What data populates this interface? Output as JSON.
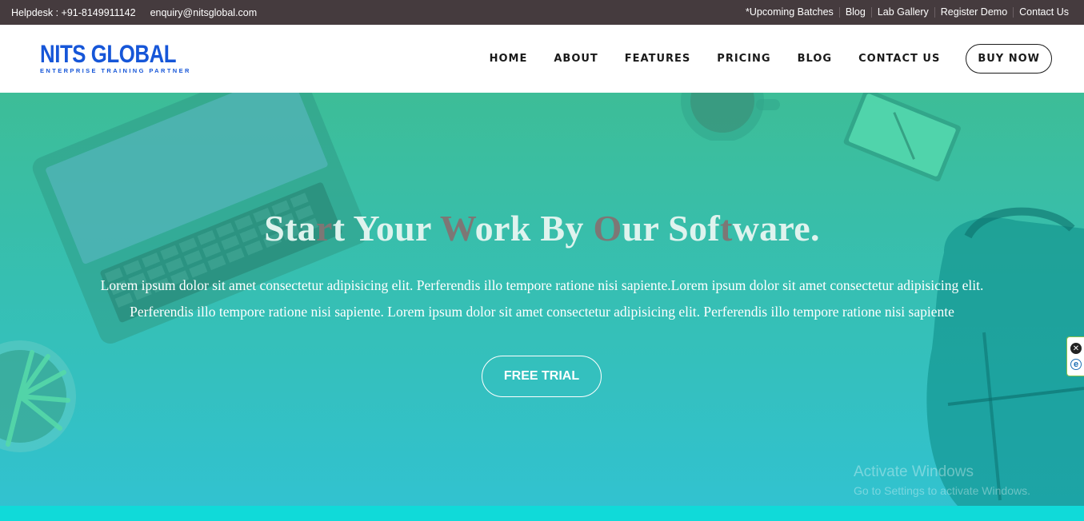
{
  "topbar": {
    "helpdesk": "Helpdesk : +91-8149911142",
    "email": "enquiry@nitsglobal.com",
    "links": [
      "*Upcoming Batches",
      "Blog",
      "Lab Gallery",
      "Register Demo",
      "Contact Us"
    ]
  },
  "logo": {
    "main": "NITS GLOBAL",
    "tagline": "ENTERPRISE TRAINING PARTNER"
  },
  "nav": {
    "items": [
      "HOME",
      "ABOUT",
      "FEATURES",
      "PRICING",
      "BLOG",
      "CONTACT US"
    ],
    "cta": "BUY NOW"
  },
  "hero": {
    "title_parts": [
      {
        "t": "Sta",
        "hl": false
      },
      {
        "t": "r",
        "hl": true
      },
      {
        "t": "t Your ",
        "hl": false
      },
      {
        "t": "W",
        "hl": true
      },
      {
        "t": "ork By ",
        "hl": false
      },
      {
        "t": "O",
        "hl": true
      },
      {
        "t": "ur Sof",
        "hl": false
      },
      {
        "t": "t",
        "hl": true
      },
      {
        "t": "ware.",
        "hl": false
      }
    ],
    "line1": "Lorem ipsum dolor sit amet consectetur adipisicing elit. Perferendis illo tempore ratione nisi sapiente.Lorem ipsum dolor sit amet consectetur adipisicing elit.",
    "line2": "Perferendis illo tempore ratione nisi sapiente. Lorem ipsum dolor sit amet consectetur adipisicing elit. Perferendis illo tempore ratione nisi sapiente",
    "cta": "FREE TRIAL"
  },
  "watermark": {
    "line1": "Activate Windows",
    "line2": "Go to Settings to activate Windows."
  },
  "colors": {
    "topbar": "#453b3e",
    "brand": "#1656d8",
    "hero_top": "#3dbd97",
    "hero_bottom": "#31c2d2",
    "strip": "#10dad9"
  },
  "icons": {
    "widget_close": "close-circle-icon",
    "widget_browser": "edge-e-icon"
  }
}
